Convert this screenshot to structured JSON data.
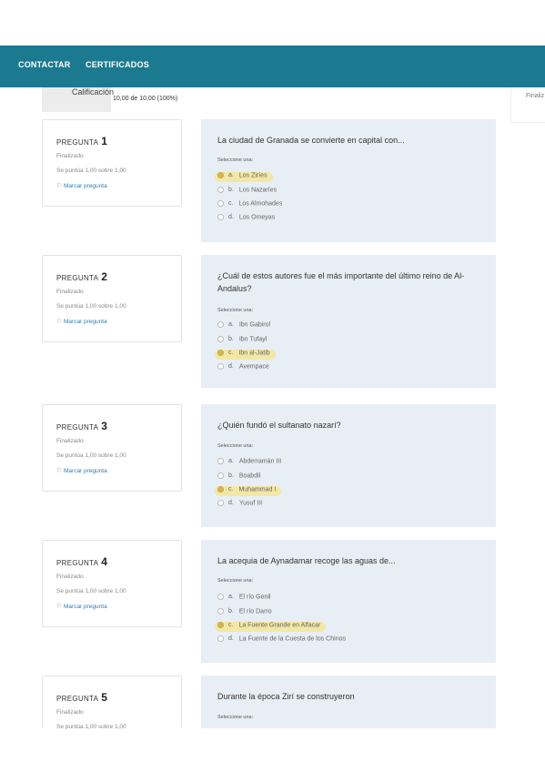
{
  "nav": {
    "contact": "CONTACTAR",
    "certificates": "CERTIFICADOS"
  },
  "summary": {
    "grade_label": "Calificación",
    "grade_value": "10,00 de 10,00 (100%)",
    "side_text": "Finaliz"
  },
  "questions": [
    {
      "label": "PREGUNTA",
      "number": "1",
      "state": "Finalizado",
      "grade": "Se puntúa 1,00 sobre 1,00",
      "flag": "Marcar pregunta",
      "text": "La ciudad de Granada se convierte en capital con...",
      "select_label": "Seleccione una:",
      "options": [
        {
          "letter": "a.",
          "text": "Los Ziríes",
          "selected": true
        },
        {
          "letter": "b.",
          "text": "Los Nazaríes",
          "selected": false
        },
        {
          "letter": "c.",
          "text": "Los Almohades",
          "selected": false
        },
        {
          "letter": "d.",
          "text": "Los Omeyas",
          "selected": false
        }
      ]
    },
    {
      "label": "PREGUNTA",
      "number": "2",
      "state": "Finalizado",
      "grade": "Se puntúa 1,00 sobre 1,00",
      "flag": "Marcar pregunta",
      "text": "¿Cuál de estos autores fue el más importante del último reino de Al-Andalus?",
      "select_label": "Seleccione una:",
      "options": [
        {
          "letter": "a.",
          "text": "Ibn Gabirol",
          "selected": false
        },
        {
          "letter": "b.",
          "text": "Ibn Tufayl",
          "selected": false
        },
        {
          "letter": "c.",
          "text": "Ibn al-Jatib",
          "selected": true
        },
        {
          "letter": "d.",
          "text": "Avempace",
          "selected": false
        }
      ]
    },
    {
      "label": "PREGUNTA",
      "number": "3",
      "state": "Finalizado",
      "grade": "Se puntúa 1,00 sobre 1,00",
      "flag": "Marcar pregunta",
      "text": "¿Quién fundó el sultanato nazarí?",
      "select_label": "Seleccione una:",
      "options": [
        {
          "letter": "a.",
          "text": "Abderramán III",
          "selected": false
        },
        {
          "letter": "b.",
          "text": "Boabdil",
          "selected": false
        },
        {
          "letter": "c.",
          "text": "Muhammad I",
          "selected": true
        },
        {
          "letter": "d.",
          "text": "Yusuf III",
          "selected": false
        }
      ]
    },
    {
      "label": "PREGUNTA",
      "number": "4",
      "state": "Finalizado",
      "grade": "Se puntúa 1,00 sobre 1,00",
      "flag": "Marcar pregunta",
      "text": "La acequia de Aynadamar recoge las aguas de...",
      "select_label": "Seleccione una:",
      "options": [
        {
          "letter": "a.",
          "text": "El río Genil",
          "selected": false
        },
        {
          "letter": "b.",
          "text": "El río Darro",
          "selected": false
        },
        {
          "letter": "c.",
          "text": "La Fuente Grande en Alfacar",
          "selected": true
        },
        {
          "letter": "d.",
          "text": "La Fuente de la Cuesta de los Chinos",
          "selected": false
        }
      ]
    },
    {
      "label": "PREGUNTA",
      "number": "5",
      "state": "Finalizado",
      "grade": "Se puntúa 1,00 sobre 1,00",
      "flag": "",
      "text": "Durante la época Zirí se construyeron",
      "select_label": "Seleccione una:",
      "options": []
    }
  ]
}
